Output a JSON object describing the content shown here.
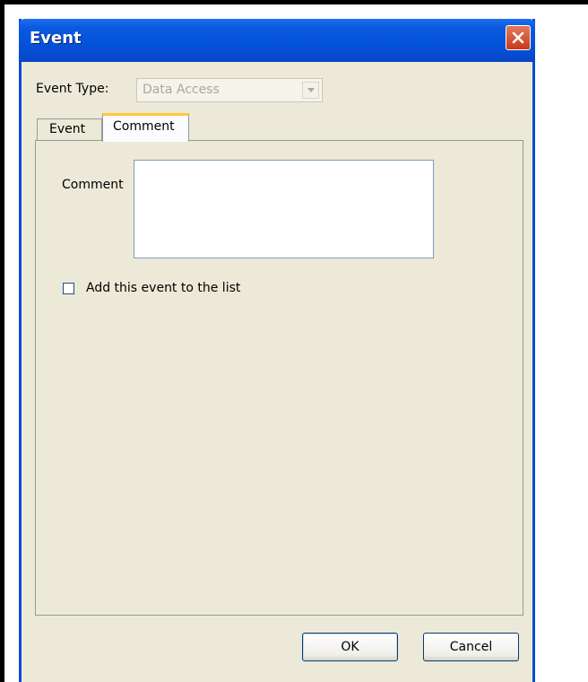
{
  "window": {
    "title": "Event"
  },
  "form": {
    "event_type_label": "Event Type:",
    "event_type_value": "Data Access"
  },
  "tabs": [
    {
      "label": "Event",
      "selected": false
    },
    {
      "label": "Comment",
      "selected": true
    }
  ],
  "comment_tab": {
    "comment_label": "Comment",
    "comment_value": "",
    "checkbox_label": "Add this event to the list",
    "checkbox_checked": false
  },
  "buttons": {
    "ok": "OK",
    "cancel": "Cancel"
  },
  "icons": {
    "close": "close-icon",
    "dropdown": "chevron-down-icon"
  }
}
